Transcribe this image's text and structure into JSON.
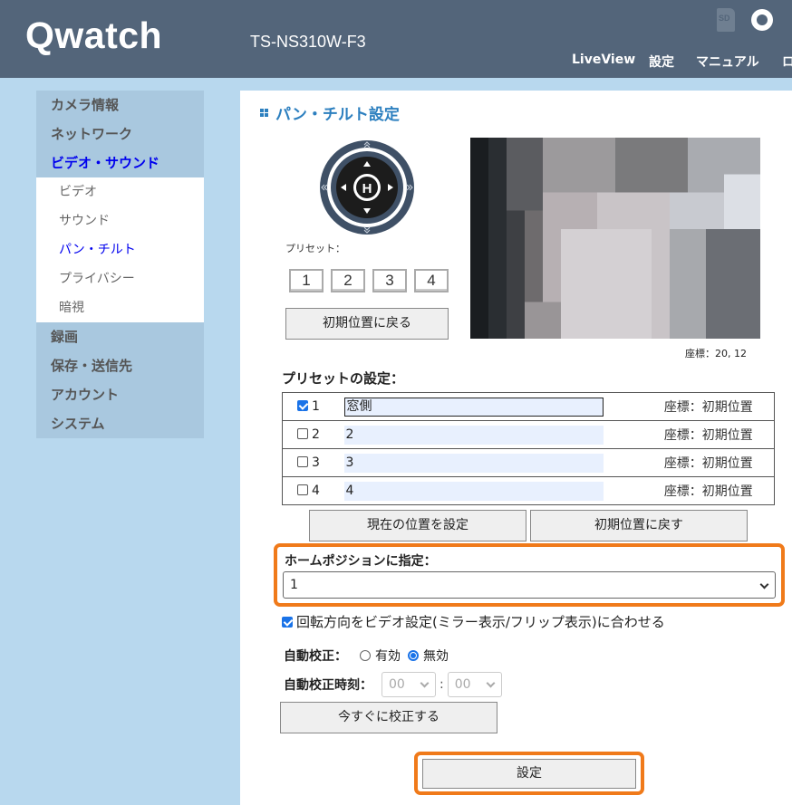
{
  "header": {
    "logo": "Qwatch",
    "model": "TS-NS310W-F3",
    "sd_icon_text": "SD",
    "icons": [
      "sd-card-icon",
      "record-icon"
    ],
    "nav": [
      "LiveView",
      "設定",
      "マニュアル",
      "ロ"
    ]
  },
  "sidebar": {
    "items": [
      {
        "label": "カメラ情報"
      },
      {
        "label": "ネットワーク"
      },
      {
        "label": "ビデオ・サウンド",
        "active": true
      },
      {
        "label": "録画"
      },
      {
        "label": "保存・送信先"
      },
      {
        "label": "アカウント"
      },
      {
        "label": "システム"
      }
    ],
    "subitems": [
      {
        "label": "ビデオ"
      },
      {
        "label": "サウンド"
      },
      {
        "label": "パン・チルト",
        "active": true
      },
      {
        "label": "プライバシー"
      },
      {
        "label": "暗視"
      }
    ]
  },
  "main": {
    "title": "パン・チルト設定",
    "ptz_center": "H",
    "preset_label": "プリセット：",
    "preset_buttons": [
      "1",
      "2",
      "3",
      "4"
    ],
    "return_button": "初期位置に戻る",
    "coords": "座標：20, 12",
    "preset_section_title": "プリセットの設定：",
    "presets": [
      {
        "num": "1",
        "checked": true,
        "name": "窓側",
        "coord": "座標：初期位置"
      },
      {
        "num": "2",
        "checked": false,
        "name": "2",
        "coord": "座標：初期位置"
      },
      {
        "num": "3",
        "checked": false,
        "name": "3",
        "coord": "座標：初期位置"
      },
      {
        "num": "4",
        "checked": false,
        "name": "4",
        "coord": "座標：初期位置"
      }
    ],
    "set_position_button": "現在の位置を設定",
    "reset_position_button": "初期位置に戻す",
    "home_label": "ホームポジションに指定：",
    "home_value": "1",
    "mirror_label": "回転方向をビデオ設定(ミラー表示/フリップ表示)に合わせる",
    "mirror_checked": true,
    "auto_calib_label": "自動校正：",
    "auto_calib_options": [
      "有効",
      "無効"
    ],
    "auto_calib_selected": "無効",
    "calib_time_label": "自動校正時刻：",
    "calib_hour": "00",
    "calib_minute": "00",
    "time_separator": ":",
    "calibrate_now_button": "今すぐに校正する",
    "submit_button": "設定"
  },
  "colors": {
    "header_bg": "#53657a",
    "page_bg": "#b8d8ee",
    "accent_title": "#2c7fbf",
    "highlight": "#f07a1a",
    "link_active": "#0000ee"
  }
}
